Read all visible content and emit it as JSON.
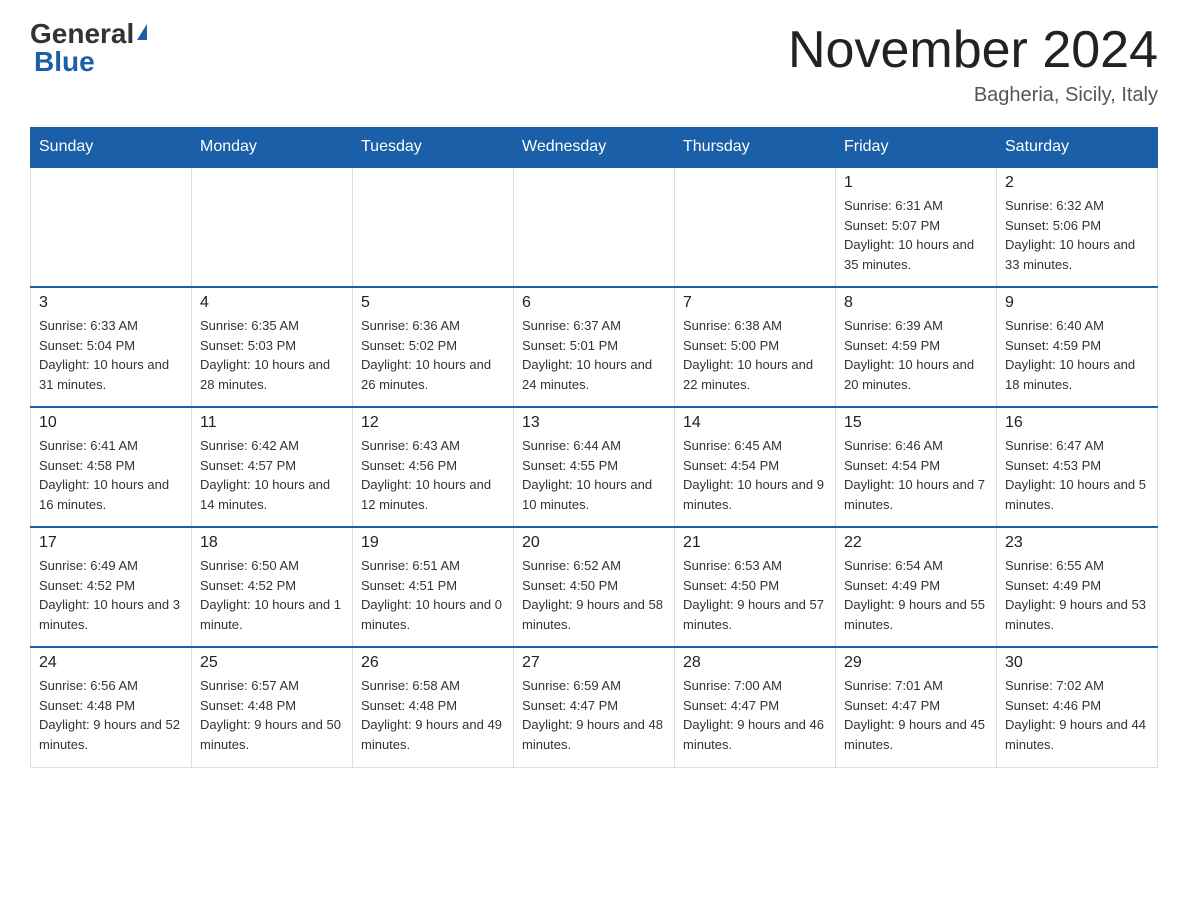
{
  "header": {
    "logo": {
      "general": "General",
      "arrow": "▶",
      "blue": "Blue"
    },
    "title": "November 2024",
    "location": "Bagheria, Sicily, Italy"
  },
  "calendar": {
    "days_of_week": [
      "Sunday",
      "Monday",
      "Tuesday",
      "Wednesday",
      "Thursday",
      "Friday",
      "Saturday"
    ],
    "weeks": [
      [
        {
          "day": "",
          "sunrise": "",
          "sunset": "",
          "daylight": ""
        },
        {
          "day": "",
          "sunrise": "",
          "sunset": "",
          "daylight": ""
        },
        {
          "day": "",
          "sunrise": "",
          "sunset": "",
          "daylight": ""
        },
        {
          "day": "",
          "sunrise": "",
          "sunset": "",
          "daylight": ""
        },
        {
          "day": "",
          "sunrise": "",
          "sunset": "",
          "daylight": ""
        },
        {
          "day": "1",
          "sunrise": "Sunrise: 6:31 AM",
          "sunset": "Sunset: 5:07 PM",
          "daylight": "Daylight: 10 hours and 35 minutes."
        },
        {
          "day": "2",
          "sunrise": "Sunrise: 6:32 AM",
          "sunset": "Sunset: 5:06 PM",
          "daylight": "Daylight: 10 hours and 33 minutes."
        }
      ],
      [
        {
          "day": "3",
          "sunrise": "Sunrise: 6:33 AM",
          "sunset": "Sunset: 5:04 PM",
          "daylight": "Daylight: 10 hours and 31 minutes."
        },
        {
          "day": "4",
          "sunrise": "Sunrise: 6:35 AM",
          "sunset": "Sunset: 5:03 PM",
          "daylight": "Daylight: 10 hours and 28 minutes."
        },
        {
          "day": "5",
          "sunrise": "Sunrise: 6:36 AM",
          "sunset": "Sunset: 5:02 PM",
          "daylight": "Daylight: 10 hours and 26 minutes."
        },
        {
          "day": "6",
          "sunrise": "Sunrise: 6:37 AM",
          "sunset": "Sunset: 5:01 PM",
          "daylight": "Daylight: 10 hours and 24 minutes."
        },
        {
          "day": "7",
          "sunrise": "Sunrise: 6:38 AM",
          "sunset": "Sunset: 5:00 PM",
          "daylight": "Daylight: 10 hours and 22 minutes."
        },
        {
          "day": "8",
          "sunrise": "Sunrise: 6:39 AM",
          "sunset": "Sunset: 4:59 PM",
          "daylight": "Daylight: 10 hours and 20 minutes."
        },
        {
          "day": "9",
          "sunrise": "Sunrise: 6:40 AM",
          "sunset": "Sunset: 4:59 PM",
          "daylight": "Daylight: 10 hours and 18 minutes."
        }
      ],
      [
        {
          "day": "10",
          "sunrise": "Sunrise: 6:41 AM",
          "sunset": "Sunset: 4:58 PM",
          "daylight": "Daylight: 10 hours and 16 minutes."
        },
        {
          "day": "11",
          "sunrise": "Sunrise: 6:42 AM",
          "sunset": "Sunset: 4:57 PM",
          "daylight": "Daylight: 10 hours and 14 minutes."
        },
        {
          "day": "12",
          "sunrise": "Sunrise: 6:43 AM",
          "sunset": "Sunset: 4:56 PM",
          "daylight": "Daylight: 10 hours and 12 minutes."
        },
        {
          "day": "13",
          "sunrise": "Sunrise: 6:44 AM",
          "sunset": "Sunset: 4:55 PM",
          "daylight": "Daylight: 10 hours and 10 minutes."
        },
        {
          "day": "14",
          "sunrise": "Sunrise: 6:45 AM",
          "sunset": "Sunset: 4:54 PM",
          "daylight": "Daylight: 10 hours and 9 minutes."
        },
        {
          "day": "15",
          "sunrise": "Sunrise: 6:46 AM",
          "sunset": "Sunset: 4:54 PM",
          "daylight": "Daylight: 10 hours and 7 minutes."
        },
        {
          "day": "16",
          "sunrise": "Sunrise: 6:47 AM",
          "sunset": "Sunset: 4:53 PM",
          "daylight": "Daylight: 10 hours and 5 minutes."
        }
      ],
      [
        {
          "day": "17",
          "sunrise": "Sunrise: 6:49 AM",
          "sunset": "Sunset: 4:52 PM",
          "daylight": "Daylight: 10 hours and 3 minutes."
        },
        {
          "day": "18",
          "sunrise": "Sunrise: 6:50 AM",
          "sunset": "Sunset: 4:52 PM",
          "daylight": "Daylight: 10 hours and 1 minute."
        },
        {
          "day": "19",
          "sunrise": "Sunrise: 6:51 AM",
          "sunset": "Sunset: 4:51 PM",
          "daylight": "Daylight: 10 hours and 0 minutes."
        },
        {
          "day": "20",
          "sunrise": "Sunrise: 6:52 AM",
          "sunset": "Sunset: 4:50 PM",
          "daylight": "Daylight: 9 hours and 58 minutes."
        },
        {
          "day": "21",
          "sunrise": "Sunrise: 6:53 AM",
          "sunset": "Sunset: 4:50 PM",
          "daylight": "Daylight: 9 hours and 57 minutes."
        },
        {
          "day": "22",
          "sunrise": "Sunrise: 6:54 AM",
          "sunset": "Sunset: 4:49 PM",
          "daylight": "Daylight: 9 hours and 55 minutes."
        },
        {
          "day": "23",
          "sunrise": "Sunrise: 6:55 AM",
          "sunset": "Sunset: 4:49 PM",
          "daylight": "Daylight: 9 hours and 53 minutes."
        }
      ],
      [
        {
          "day": "24",
          "sunrise": "Sunrise: 6:56 AM",
          "sunset": "Sunset: 4:48 PM",
          "daylight": "Daylight: 9 hours and 52 minutes."
        },
        {
          "day": "25",
          "sunrise": "Sunrise: 6:57 AM",
          "sunset": "Sunset: 4:48 PM",
          "daylight": "Daylight: 9 hours and 50 minutes."
        },
        {
          "day": "26",
          "sunrise": "Sunrise: 6:58 AM",
          "sunset": "Sunset: 4:48 PM",
          "daylight": "Daylight: 9 hours and 49 minutes."
        },
        {
          "day": "27",
          "sunrise": "Sunrise: 6:59 AM",
          "sunset": "Sunset: 4:47 PM",
          "daylight": "Daylight: 9 hours and 48 minutes."
        },
        {
          "day": "28",
          "sunrise": "Sunrise: 7:00 AM",
          "sunset": "Sunset: 4:47 PM",
          "daylight": "Daylight: 9 hours and 46 minutes."
        },
        {
          "day": "29",
          "sunrise": "Sunrise: 7:01 AM",
          "sunset": "Sunset: 4:47 PM",
          "daylight": "Daylight: 9 hours and 45 minutes."
        },
        {
          "day": "30",
          "sunrise": "Sunrise: 7:02 AM",
          "sunset": "Sunset: 4:46 PM",
          "daylight": "Daylight: 9 hours and 44 minutes."
        }
      ]
    ]
  }
}
